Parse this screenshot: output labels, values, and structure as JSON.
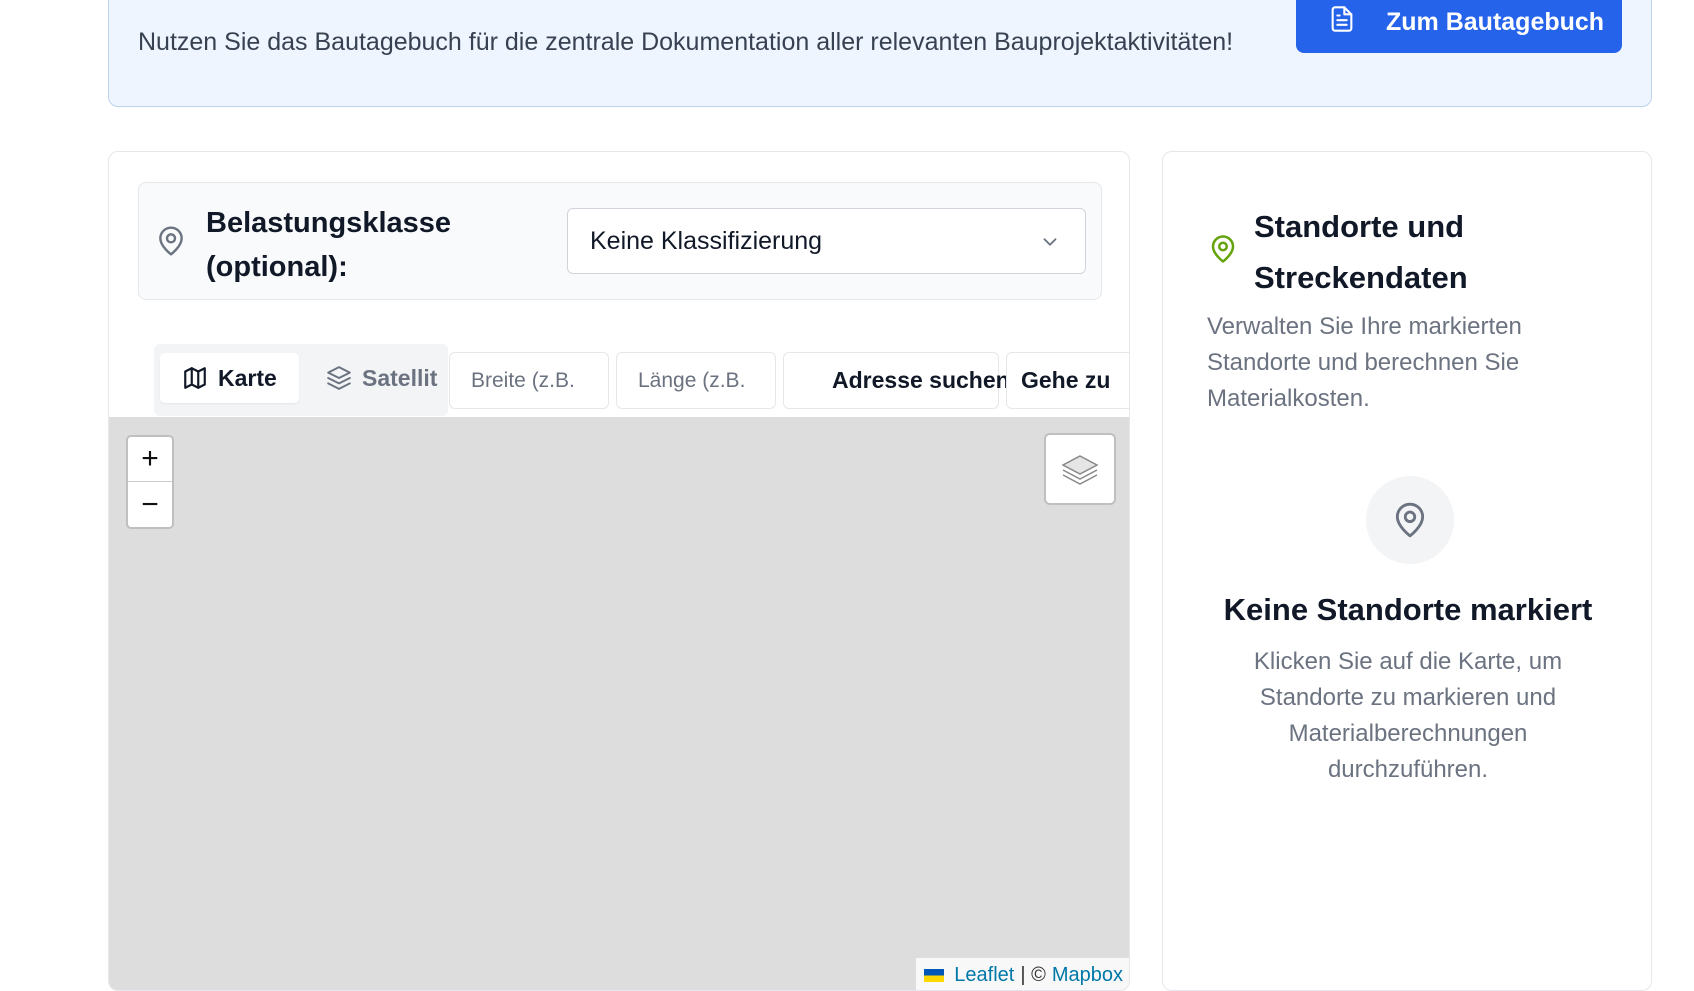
{
  "banner": {
    "text": "Nutzen Sie das Bautagebuch für die zentrale Dokumentation aller relevanten Bauprojektaktivitäten!",
    "button_label": "Zum Bautagebuch",
    "button_icon": "document-icon"
  },
  "load_class": {
    "label": "Belastungsklasse (optional):",
    "icon": "map-pin-icon",
    "select_value": "Keine Klassifizierung"
  },
  "toolbar": {
    "tab_map": "Karte",
    "tab_satellite": "Satellit",
    "lat_placeholder": "Breite (z.B.",
    "lng_placeholder": "Länge (z.B.",
    "search_address": "Adresse suchen",
    "goto": "Gehe zu"
  },
  "map": {
    "zoom_in": "+",
    "zoom_out": "−",
    "attribution_leaflet": "Leaflet",
    "attribution_sep": "| ©",
    "attribution_provider": "Mapbox"
  },
  "locations": {
    "title": "Standorte und Streckendaten",
    "description": "Verwalten Sie Ihre markierten Standorte und berechnen Sie Materialkosten.",
    "empty_title": "Keine Standorte markiert",
    "empty_description": "Klicken Sie auf die Karte, um Standorte zu markieren und Materialberechnungen durchzuführen."
  },
  "colors": {
    "primary": "#2563eb",
    "accent_green": "#65a30d",
    "banner_bg": "#eef5fe",
    "map_bg": "#dddddd"
  }
}
